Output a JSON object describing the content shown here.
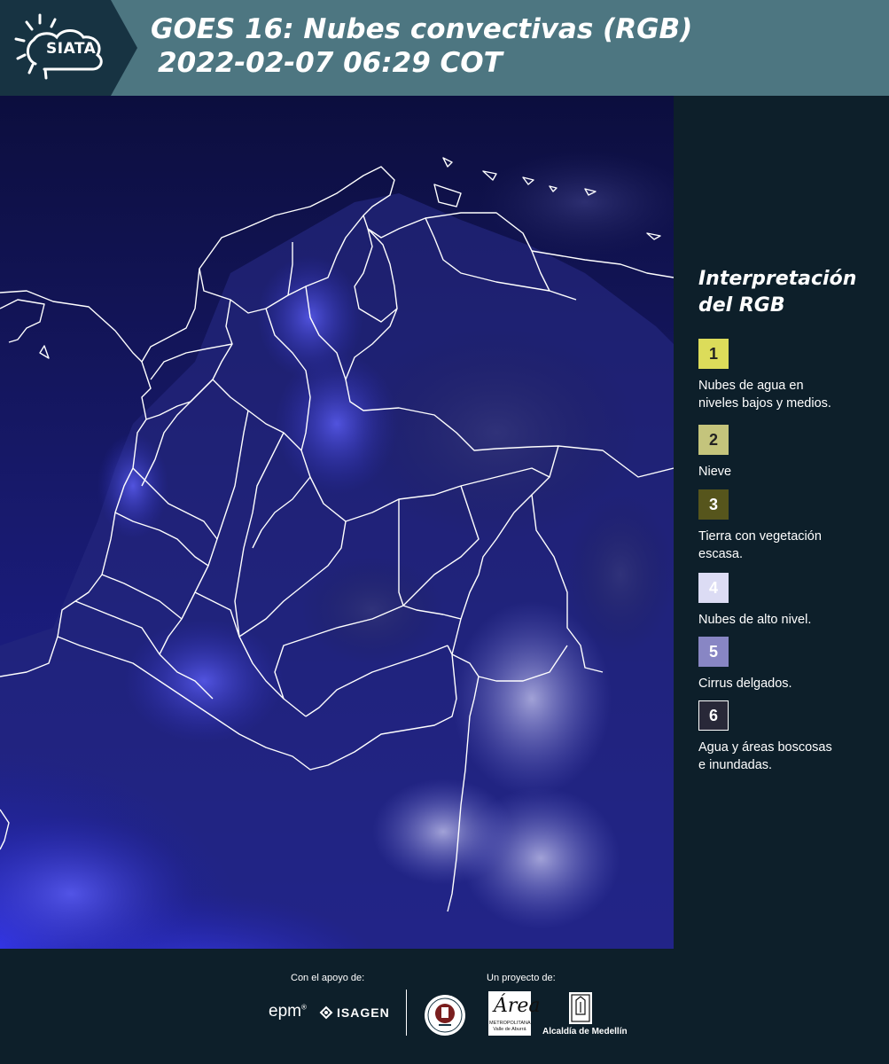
{
  "header": {
    "logo_text": "SIATA",
    "title_line1": "GOES 16: Nubes convectivas (RGB)",
    "title_line2": "2022-02-07 06:29 COT",
    "background": "#4d7681"
  },
  "map": {
    "description_colors": {
      "water": "#0b0d3a",
      "clouds_high": "#5a5cf2",
      "clouds_light": "#c8c8e8",
      "borders": "#ffffff"
    }
  },
  "legend": {
    "title_line1": "Interpretación",
    "title_line2": "del RGB",
    "items": [
      {
        "number": "1",
        "color": "#dcdc5a",
        "label_line1": "Nubes de agua en",
        "label_line2": "niveles bajos y medios."
      },
      {
        "number": "2",
        "color": "#c4c47c",
        "label_line1": "Nieve",
        "label_line2": ""
      },
      {
        "number": "3",
        "color": "#56551c",
        "label_line1": "Tierra con vegetación",
        "label_line2": "escasa."
      },
      {
        "number": "4",
        "color": "#dcdcf4",
        "label_line1": "Nubes de alto nivel.",
        "label_line2": ""
      },
      {
        "number": "5",
        "color": "#8886c4",
        "label_line1": "Cirrus delgados.",
        "label_line2": ""
      },
      {
        "number": "6",
        "color": "#282838",
        "label_line1": "Agua y áreas boscosas",
        "label_line2": "e inundadas."
      }
    ]
  },
  "footer": {
    "support_label": "Con el apoyo de:",
    "project_label": "Un proyecto de:",
    "epm_logo": "epm",
    "isagen_logo": "ISAGEN",
    "area_logo_big": "Área",
    "area_logo_small": "METROPOLITANA Valle de Aburrá",
    "alcaldia_label": "Alcaldía de Medellín"
  }
}
